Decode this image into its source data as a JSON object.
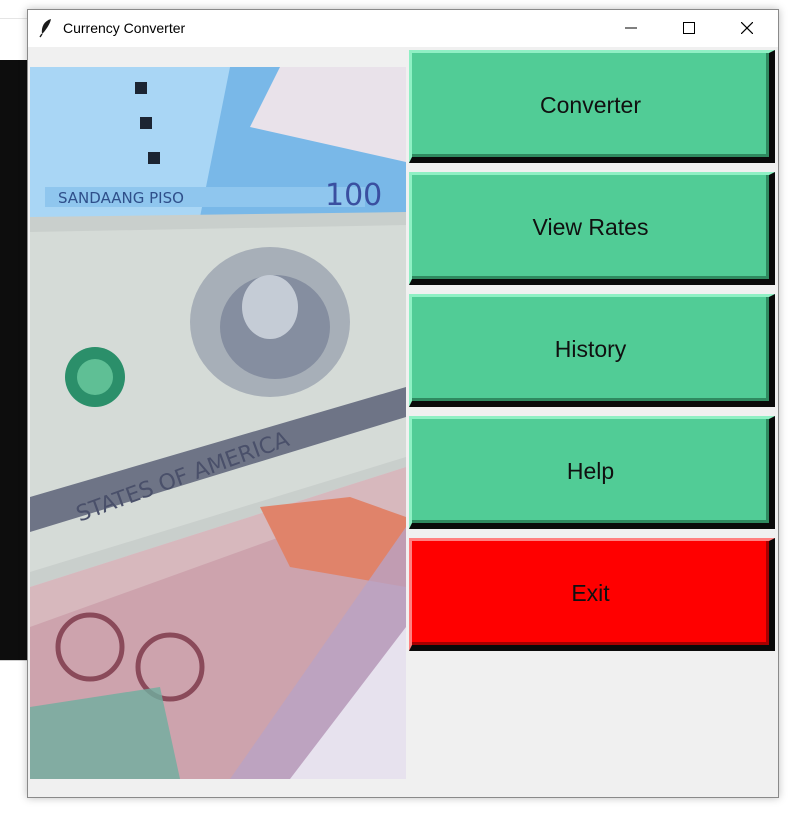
{
  "window": {
    "title": "Currency Converter",
    "controls": {
      "minimize": "minimize-icon",
      "maximize": "maximize-icon",
      "close": "close-icon"
    }
  },
  "image": {
    "description_icon": "banknotes-photo"
  },
  "menu": {
    "buttons": [
      {
        "label": "Converter",
        "color": "#51cc96"
      },
      {
        "label": "View Rates",
        "color": "#51cc96"
      },
      {
        "label": "History",
        "color": "#51cc96"
      },
      {
        "label": "Help",
        "color": "#51cc96"
      },
      {
        "label": "Exit",
        "color": "#ff0000"
      }
    ]
  }
}
